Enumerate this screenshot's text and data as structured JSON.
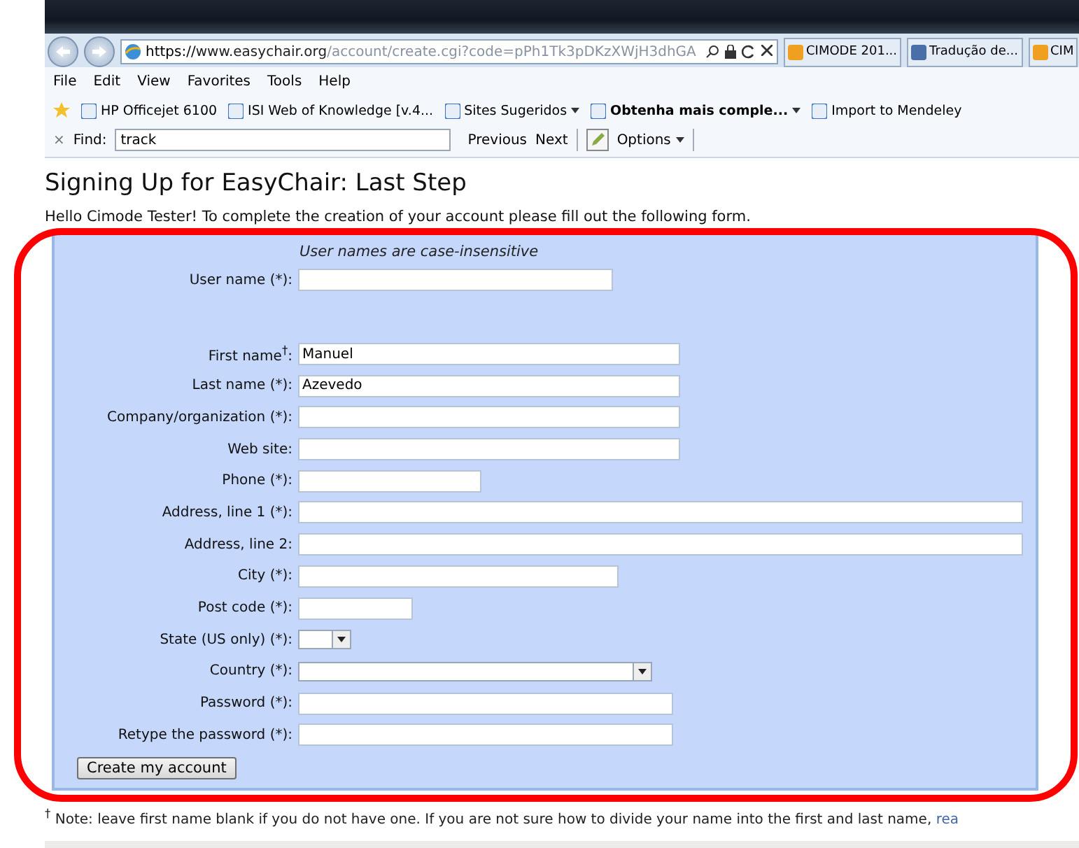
{
  "browser": {
    "url": {
      "scheme": "https://",
      "host": "www.easychair.org",
      "path": "/account/create.cgi?code=pPh1Tk3pDKzXWjH3dhGA"
    },
    "tabs": [
      {
        "label": "CIMODE 201...",
        "selected": false
      },
      {
        "label": "Tradução de...",
        "selected": false
      },
      {
        "label": "CIM",
        "selected": false
      }
    ],
    "menu": [
      "File",
      "Edit",
      "View",
      "Favorites",
      "Tools",
      "Help"
    ],
    "favorites": [
      {
        "label": "HP Officejet 6100",
        "bold": false,
        "dropdown": false
      },
      {
        "label": "ISI Web of Knowledge [v.4...",
        "bold": false,
        "dropdown": false
      },
      {
        "label": "Sites Sugeridos",
        "bold": false,
        "dropdown": true
      },
      {
        "label": "Obtenha mais comple...",
        "bold": true,
        "dropdown": true
      },
      {
        "label": "Import to Mendeley",
        "bold": false,
        "dropdown": false
      }
    ],
    "find": {
      "close": "×",
      "label": "Find:",
      "value": "track",
      "previous": "Previous",
      "next": "Next",
      "options": "Options"
    }
  },
  "page": {
    "title": "Signing Up for EasyChair: Last Step",
    "intro": "Hello Cimode Tester! To complete the creation of your account please fill out the following form.",
    "form": {
      "hint": "User names are case-insensitive",
      "fields": [
        {
          "kind": "text",
          "label": "User name (*):"
        },
        {
          "kind": "text",
          "label": "First name$^{†}$:",
          "value": "Manuel"
        },
        {
          "kind": "text",
          "label": "Last name (*):",
          "value": "Azevedo"
        },
        {
          "kind": "text",
          "label": "Company/organization (*):"
        },
        {
          "kind": "text",
          "label": "Web site:"
        },
        {
          "kind": "text",
          "label": "Phone (*):"
        },
        {
          "kind": "text",
          "label": "Address, line 1 (*):"
        },
        {
          "kind": "text",
          "label": "Address, line 2:"
        },
        {
          "kind": "text",
          "label": "City (*):"
        },
        {
          "kind": "text",
          "label": "Post code (*):"
        },
        {
          "kind": "select",
          "label": "State (US only) (*):"
        },
        {
          "kind": "select",
          "label": "Country (*):"
        },
        {
          "kind": "password",
          "label": "Password (*):"
        },
        {
          "kind": "password",
          "label": "Retype the password (*):"
        }
      ],
      "submit": "Create my account"
    },
    "footnote": {
      "mark": "†",
      "text": "Note: leave first name blank if you do not have one. If you are not sure how to divide your name into the first and last name,",
      "link": "rea"
    }
  }
}
